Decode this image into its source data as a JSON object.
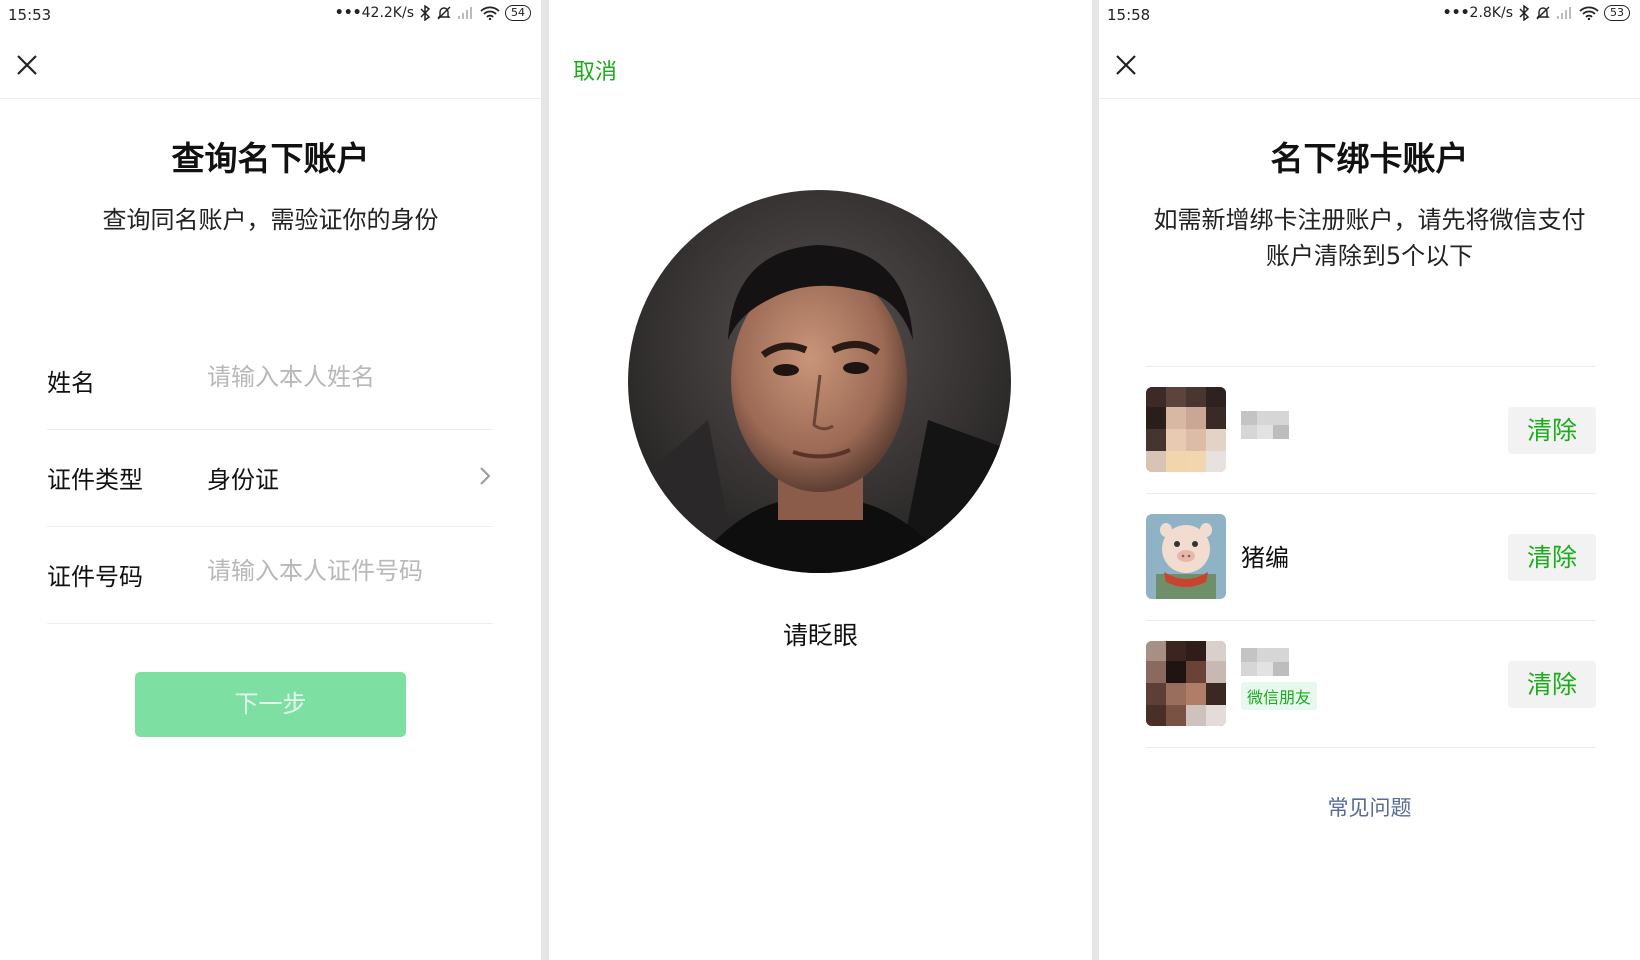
{
  "panel1": {
    "status": {
      "time": "15:53",
      "net": "42.2K/s",
      "battery": "54"
    },
    "title": "查询名下账户",
    "subtitle": "查询同名账户，需验证你的身份",
    "fields": [
      {
        "label": "姓名",
        "placeholder": "请输入本人姓名"
      },
      {
        "label": "证件类型",
        "value": "身份证"
      },
      {
        "label": "证件号码",
        "placeholder": "请输入本人证件号码"
      }
    ],
    "next_label": "下一步"
  },
  "panel2": {
    "cancel_label": "取消",
    "prompt": "请眨眼"
  },
  "panel3": {
    "status": {
      "time": "15:58",
      "net": "2.8K/s",
      "battery": "53"
    },
    "title": "名下绑卡账户",
    "subtitle": "如需新增绑卡注册账户，请先将微信支付账户清除到5个以下",
    "accounts": [
      {
        "name": "",
        "clear_label": "清除"
      },
      {
        "name": "猪编",
        "clear_label": "清除"
      },
      {
        "name": "",
        "tag": "微信朋友",
        "clear_label": "清除"
      }
    ],
    "faq": "常见问题"
  },
  "colors": {
    "green": "#1aad19",
    "button_disabled": "#7edfa2",
    "link": "#576b95"
  }
}
